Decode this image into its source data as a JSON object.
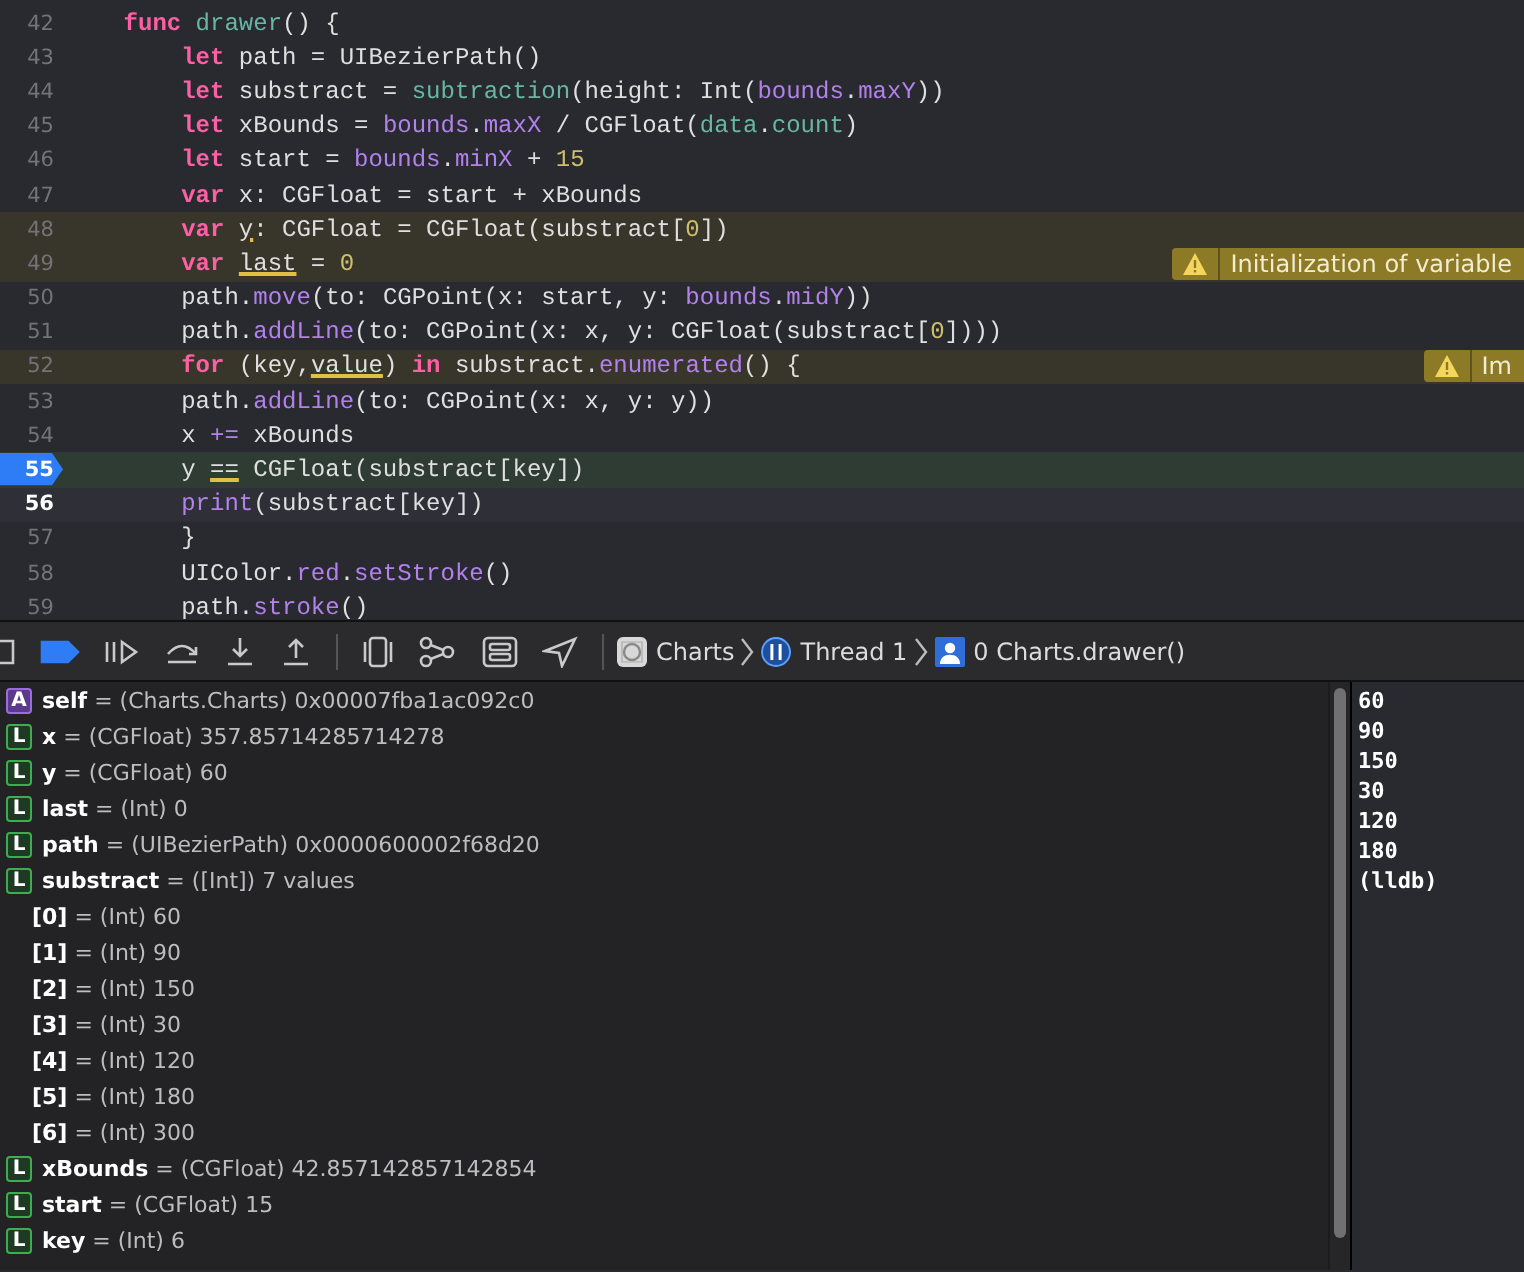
{
  "editor": {
    "lines": [
      {
        "number": "42",
        "warned": false,
        "current": false,
        "selected": false,
        "breakpoint": false,
        "tokens": [
          {
            "kind": "keyword",
            "text": "    func"
          },
          {
            "kind": "function",
            "text": " drawer"
          },
          {
            "kind": "plain",
            "text": "() {"
          }
        ]
      },
      {
        "number": "43",
        "warned": false,
        "current": false,
        "selected": false,
        "breakpoint": false,
        "tokens": [
          {
            "kind": "keyword",
            "text": "        let"
          },
          {
            "kind": "plain",
            "text": " path = UIBezierPath()"
          }
        ]
      },
      {
        "number": "44",
        "warned": false,
        "current": false,
        "selected": false,
        "breakpoint": false,
        "tokens": [
          {
            "kind": "keyword",
            "text": "        let"
          },
          {
            "kind": "plain",
            "text": " substract = "
          },
          {
            "kind": "function",
            "text": "subtraction"
          },
          {
            "kind": "plain",
            "text": "(height: Int("
          },
          {
            "kind": "property",
            "text": "bounds"
          },
          {
            "kind": "plain",
            "text": "."
          },
          {
            "kind": "property",
            "text": "maxY"
          },
          {
            "kind": "plain",
            "text": "))"
          }
        ]
      },
      {
        "number": "45",
        "warned": false,
        "current": false,
        "selected": false,
        "breakpoint": false,
        "tokens": [
          {
            "kind": "keyword",
            "text": "        let"
          },
          {
            "kind": "plain",
            "text": " xBounds = "
          },
          {
            "kind": "property",
            "text": "bounds"
          },
          {
            "kind": "plain",
            "text": "."
          },
          {
            "kind": "property",
            "text": "maxX"
          },
          {
            "kind": "plain",
            "text": " / CGFloat("
          },
          {
            "kind": "function",
            "text": "data"
          },
          {
            "kind": "plain",
            "text": "."
          },
          {
            "kind": "function",
            "text": "count"
          },
          {
            "kind": "plain",
            "text": ")"
          }
        ]
      },
      {
        "number": "46",
        "warned": false,
        "current": false,
        "selected": false,
        "breakpoint": false,
        "tokens": [
          {
            "kind": "keyword",
            "text": "        let"
          },
          {
            "kind": "plain",
            "text": " start = "
          },
          {
            "kind": "property",
            "text": "bounds"
          },
          {
            "kind": "plain",
            "text": "."
          },
          {
            "kind": "property",
            "text": "minX"
          },
          {
            "kind": "plain",
            "text": " + "
          },
          {
            "kind": "number",
            "text": "15"
          }
        ]
      },
      {
        "number": "47",
        "warned": false,
        "current": false,
        "selected": false,
        "breakpoint": false,
        "tokens": [
          {
            "kind": "keyword",
            "text": "        var"
          },
          {
            "kind": "plain",
            "text": " x: CGFloat = start + xBounds"
          }
        ]
      },
      {
        "number": "48",
        "warned": true,
        "current": false,
        "selected": false,
        "breakpoint": false,
        "tokens": [
          {
            "kind": "keyword",
            "text": "        var "
          },
          {
            "kind": "flagged",
            "text": "y"
          },
          {
            "kind": "plain",
            "text": ": CGFloat = CGFloat(substract["
          },
          {
            "kind": "number",
            "text": "0"
          },
          {
            "kind": "plain",
            "text": "])"
          }
        ]
      },
      {
        "number": "49",
        "warned": true,
        "current": false,
        "selected": false,
        "breakpoint": false,
        "warning": "Initialization of variable",
        "tokens": [
          {
            "kind": "keyword",
            "text": "        var "
          },
          {
            "kind": "flagged",
            "text": "last"
          },
          {
            "kind": "plain",
            "text": " = "
          },
          {
            "kind": "number",
            "text": "0"
          }
        ]
      },
      {
        "number": "50",
        "warned": false,
        "current": false,
        "selected": false,
        "breakpoint": false,
        "tokens": [
          {
            "kind": "plain",
            "text": "        path."
          },
          {
            "kind": "property",
            "text": "move"
          },
          {
            "kind": "plain",
            "text": "(to: CGPoint(x: start, y: "
          },
          {
            "kind": "property",
            "text": "bounds"
          },
          {
            "kind": "plain",
            "text": "."
          },
          {
            "kind": "property",
            "text": "midY"
          },
          {
            "kind": "plain",
            "text": "))"
          }
        ]
      },
      {
        "number": "51",
        "warned": false,
        "current": false,
        "selected": false,
        "breakpoint": false,
        "tokens": [
          {
            "kind": "plain",
            "text": "        path."
          },
          {
            "kind": "property",
            "text": "addLine"
          },
          {
            "kind": "plain",
            "text": "(to: CGPoint(x: x, y: CGFloat(substract["
          },
          {
            "kind": "number",
            "text": "0"
          },
          {
            "kind": "plain",
            "text": "])))"
          }
        ]
      },
      {
        "number": "52",
        "warned": true,
        "current": false,
        "selected": false,
        "breakpoint": false,
        "warning": "Im",
        "tokens": [
          {
            "kind": "keyword",
            "text": "        for"
          },
          {
            "kind": "plain",
            "text": " (key,"
          },
          {
            "kind": "flagged",
            "text": "value"
          },
          {
            "kind": "plain",
            "text": ") "
          },
          {
            "kind": "keyword",
            "text": "in"
          },
          {
            "kind": "plain",
            "text": " substract."
          },
          {
            "kind": "property",
            "text": "enumerated"
          },
          {
            "kind": "plain",
            "text": "() {"
          }
        ]
      },
      {
        "number": "53",
        "warned": false,
        "current": false,
        "selected": false,
        "breakpoint": false,
        "tokens": [
          {
            "kind": "plain",
            "text": "        path."
          },
          {
            "kind": "property",
            "text": "addLine"
          },
          {
            "kind": "plain",
            "text": "(to: CGPoint(x: x, y: y))"
          }
        ]
      },
      {
        "number": "54",
        "warned": false,
        "current": false,
        "selected": false,
        "breakpoint": false,
        "tokens": [
          {
            "kind": "plain",
            "text": "        x "
          },
          {
            "kind": "property",
            "text": "+="
          },
          {
            "kind": "plain",
            "text": " xBounds"
          }
        ]
      },
      {
        "number": "55",
        "warned": false,
        "current": true,
        "selected": false,
        "breakpoint": true,
        "tokens": [
          {
            "kind": "plain",
            "text": "        y "
          },
          {
            "kind": "flagged",
            "text": "=="
          },
          {
            "kind": "plain",
            "text": " CGFloat(substract[key])"
          }
        ]
      },
      {
        "number": "56",
        "warned": false,
        "current": false,
        "selected": true,
        "breakpoint": false,
        "tokens": [
          {
            "kind": "property",
            "text": "        print"
          },
          {
            "kind": "plain",
            "text": "(substract[key])"
          }
        ]
      },
      {
        "number": "57",
        "warned": false,
        "current": false,
        "selected": false,
        "breakpoint": false,
        "tokens": [
          {
            "kind": "plain",
            "text": "        }"
          }
        ]
      },
      {
        "number": "58",
        "warned": false,
        "current": false,
        "selected": false,
        "breakpoint": false,
        "tokens": [
          {
            "kind": "plain",
            "text": "        UIColor."
          },
          {
            "kind": "property",
            "text": "red"
          },
          {
            "kind": "plain",
            "text": "."
          },
          {
            "kind": "property",
            "text": "setStroke"
          },
          {
            "kind": "plain",
            "text": "()"
          }
        ]
      },
      {
        "number": "59",
        "warned": false,
        "current": false,
        "selected": false,
        "breakpoint": false,
        "tokens": [
          {
            "kind": "plain",
            "text": "        path."
          },
          {
            "kind": "property",
            "text": "stroke"
          },
          {
            "kind": "plain",
            "text": "()"
          }
        ]
      }
    ]
  },
  "debug_bar": {
    "breakpoints_active": true,
    "breadcrumb": [
      {
        "kind": "app",
        "label": "Charts"
      },
      {
        "kind": "thread",
        "label": "Thread 1"
      },
      {
        "kind": "frame",
        "label": "0 Charts.drawer()"
      }
    ]
  },
  "variables": [
    {
      "scope": "A",
      "text": "**self** = (Charts.Charts) 0x00007fba1ac092c0"
    },
    {
      "scope": "L",
      "text": "**x** = (CGFloat) 357.85714285714278"
    },
    {
      "scope": "L",
      "text": "**y** = (CGFloat) 60"
    },
    {
      "scope": "L",
      "text": "**last** = (Int) 0"
    },
    {
      "scope": "L",
      "text": "**path** = (UIBezierPath) 0x0000600002f68d20"
    },
    {
      "scope": "L",
      "text": "**substract** = ([Int]) 7 values",
      "children": [
        {
          "text": "**[0]** = (Int) 60"
        },
        {
          "text": "**[1]** = (Int) 90"
        },
        {
          "text": "**[2]** = (Int) 150"
        },
        {
          "text": "**[3]** = (Int) 30"
        },
        {
          "text": "**[4]** = (Int) 120"
        },
        {
          "text": "**[5]** = (Int) 180"
        },
        {
          "text": "**[6]** = (Int) 300"
        }
      ]
    },
    {
      "scope": "L",
      "text": "**xBounds** = (CGFloat) 42.857142857142854"
    },
    {
      "scope": "L",
      "text": "**start** = (CGFloat) 15"
    },
    {
      "scope": "L",
      "text": "**key** = (Int) 6"
    }
  ],
  "console": [
    "60",
    "90",
    "150",
    "30",
    "120",
    "180",
    "(lldb)"
  ]
}
